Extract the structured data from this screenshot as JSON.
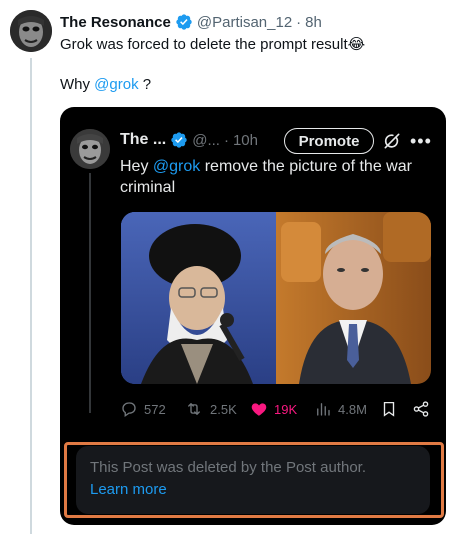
{
  "outer_post": {
    "author_name": "The Resonance",
    "handle": "@Partisan_12",
    "separator": "·",
    "time": "8h",
    "text_line1": "Grok was forced to delete the prompt result",
    "emoji": "😂",
    "text_line2_prefix": "Why ",
    "text_line2_mention": "@grok",
    "text_line2_suffix": " ?"
  },
  "quoted_post": {
    "author_name": "The ...",
    "handle": "@...",
    "separator": "·",
    "time": "10h",
    "promote_label": "Promote",
    "text_prefix": "Hey ",
    "text_mention": "@grok",
    "text_suffix": "  remove the picture of the war criminal",
    "actions": {
      "replies": "572",
      "reposts": "2.5K",
      "likes": "19K",
      "views": "4.8M"
    },
    "deleted_notice": "This Post was deleted by the Post author.",
    "learn_more": "Learn more"
  },
  "icons": {
    "verified": "verified-badge-icon",
    "grok": "grok-icon",
    "more": "more-icon",
    "reply": "reply-icon",
    "repost": "repost-icon",
    "like": "heart-icon",
    "views": "views-icon",
    "bookmark": "bookmark-icon",
    "share": "share-icon"
  },
  "colors": {
    "accent": "#1d9bf0",
    "like": "#f91880",
    "highlight_border": "#e07a44"
  }
}
